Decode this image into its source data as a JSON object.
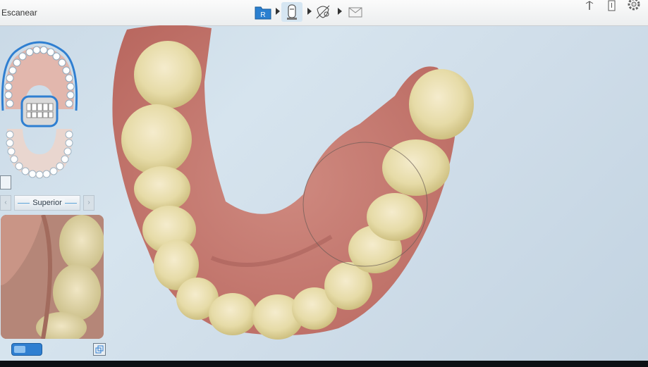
{
  "app": {
    "title": "Escanear"
  },
  "workflow": {
    "steps": [
      {
        "icon": "prescription-r-icon",
        "label": "R",
        "active": false
      },
      {
        "icon": "scanner-wand-icon",
        "active": true
      },
      {
        "icon": "model-check-icon",
        "active": false
      },
      {
        "icon": "envelope-icon",
        "active": false
      }
    ]
  },
  "toolbar_right": [
    "antenna-icon",
    "battery-icon",
    "settings-gear-icon"
  ],
  "sidebar": {
    "arch_selector": {
      "selected": "upper-arch"
    },
    "view_label": "Superior",
    "preview_toggle": "on"
  },
  "colors": {
    "accent": "#2f7fd1",
    "viewport_bg": "#d2e0ea",
    "gum": "#c9776d",
    "tooth": "#e6dca9"
  }
}
